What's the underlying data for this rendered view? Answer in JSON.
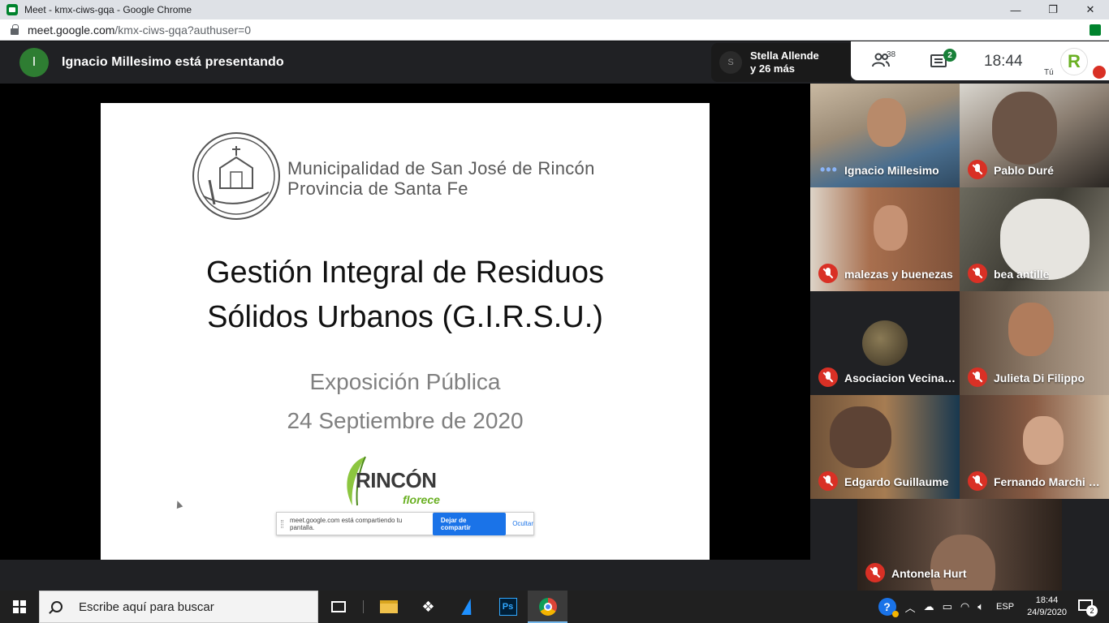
{
  "window": {
    "title": "Meet - kmx-ciws-gqa - Google Chrome",
    "url_host": "meet.google.com",
    "url_path": "/kmx-ciws-gqa?authuser=0"
  },
  "meet": {
    "presenter_initial": "I",
    "presenter_text": "Ignacio Millesimo está presentando",
    "people_chip_initial": "S",
    "people_chip_line1": "Stella Allende",
    "people_chip_line2": "y 26 más",
    "participant_count": "38",
    "chat_badge": "2",
    "clock": "18:44",
    "you_label": "Tú",
    "self_logo_letter": "R"
  },
  "slide": {
    "muni_line1": "Municipalidad de San José de Rincón",
    "muni_line2": "Provincia de Santa Fe",
    "title_line1": "Gestión Integral de Residuos",
    "title_line2": "Sólidos Urbanos (G.I.R.S.U.)",
    "subtitle_line1": "Exposición Pública",
    "subtitle_line2": "24 Septiembre de 2020",
    "logo_big": "RINCÓN",
    "logo_small": "florece",
    "share_message": "meet.google.com está compartiendo tu pantalla.",
    "stop_share": "Dejar de compartir",
    "hide": "Ocultar"
  },
  "tiles": [
    {
      "name": "Ignacio Millesimo",
      "muted": false
    },
    {
      "name": "Pablo Duré",
      "muted": true
    },
    {
      "name": "malezas y buenezas",
      "muted": true
    },
    {
      "name": "bea antille",
      "muted": true
    },
    {
      "name": "Asociacion Vecinal C...",
      "muted": true
    },
    {
      "name": "Julieta Di Filippo",
      "muted": true
    },
    {
      "name": "Edgardo Guillaume",
      "muted": true
    },
    {
      "name": "Fernando Marchi Sc...",
      "muted": true
    },
    {
      "name": "Antonela Hurt",
      "muted": true
    }
  ],
  "taskbar": {
    "search_placeholder": "Escribe aquí para buscar",
    "ps_label": "Ps",
    "language": "ESP",
    "time": "18:44",
    "date": "24/9/2020",
    "notification_count": "2"
  }
}
